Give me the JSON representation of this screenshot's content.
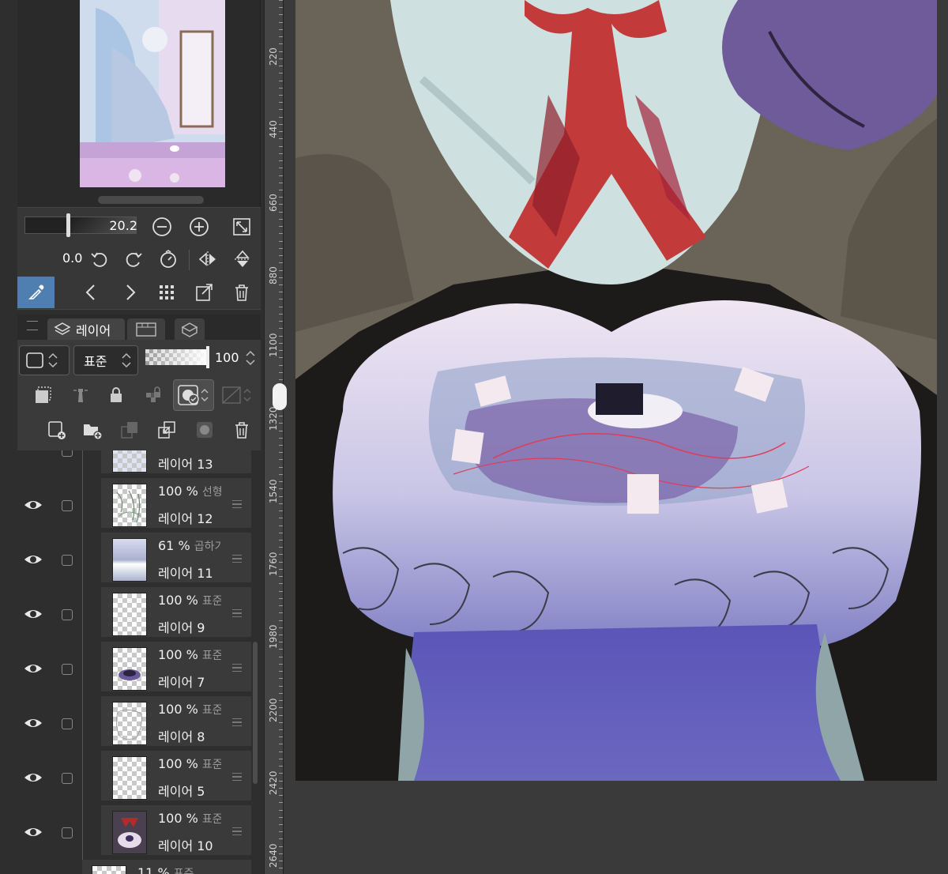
{
  "navigator": {
    "zoom_value": "20.2",
    "rotation_value": "0.0"
  },
  "tabs": {
    "layer": "레이어"
  },
  "layer_props": {
    "blend_mode": "표준",
    "opacity": "100"
  },
  "ruler": {
    "labels": [
      "220",
      "440",
      "660",
      "880",
      "1100",
      "1320",
      "1540",
      "1760",
      "1980",
      "2200",
      "2420",
      "2640"
    ]
  },
  "layers": [
    {
      "opacity": "",
      "mode": "",
      "name": "레이어 13"
    },
    {
      "opacity": "100 %",
      "mode": "선형",
      "name": "레이어 12"
    },
    {
      "opacity": "61 %",
      "mode": "곱하기",
      "name": "레이어 11"
    },
    {
      "opacity": "100 %",
      "mode": "표준",
      "name": "레이어 9"
    },
    {
      "opacity": "100 %",
      "mode": "표준",
      "name": "레이어 7"
    },
    {
      "opacity": "100 %",
      "mode": "표준",
      "name": "레이어 8"
    },
    {
      "opacity": "100 %",
      "mode": "표준",
      "name": "레이어 5"
    },
    {
      "opacity": "100 %",
      "mode": "표준",
      "name": "레이어 10"
    },
    {
      "opacity": "11 %",
      "mode": "표준",
      "name": ""
    }
  ],
  "colors": {
    "accent": "#4f7fb0",
    "panel_bg": "#2e2e2e",
    "canvas_bg": "#1b1a18"
  }
}
